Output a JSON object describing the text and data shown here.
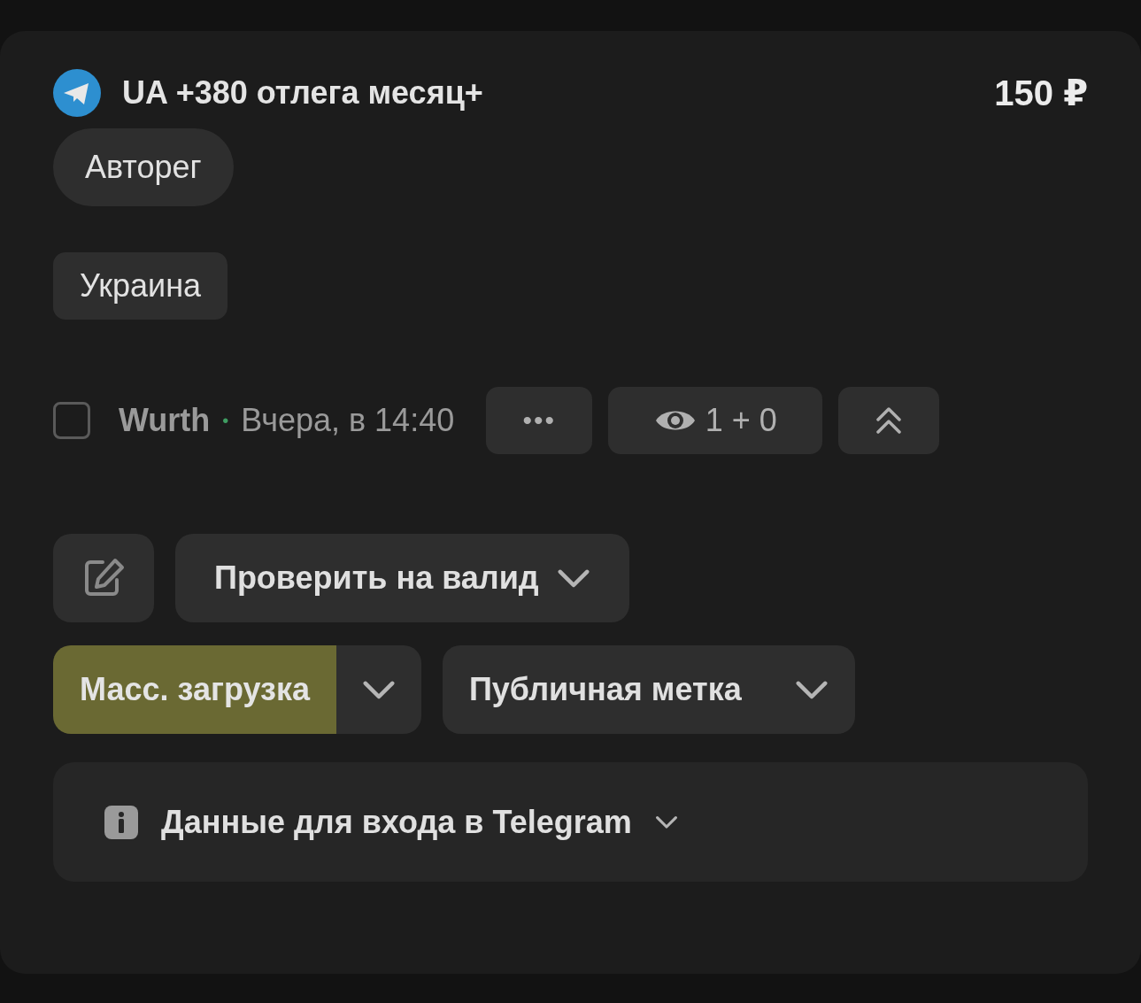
{
  "listing": {
    "title": "UA +380 отлега месяц+",
    "price": "150 ₽"
  },
  "tags": [
    {
      "label": "Авторег",
      "kind": "pill"
    },
    {
      "label": "Украина",
      "kind": "rect"
    }
  ],
  "meta": {
    "checked": false,
    "author": "Wurth",
    "separator": "•",
    "time": "Вчера, в 14:40",
    "more": "•••",
    "views": "1 + 0"
  },
  "actions": {
    "check_label": "Проверить на валид",
    "mass_upload": "Масс. загрузка",
    "public_tag": "Публичная метка"
  },
  "info": {
    "label": "Данные для входа в Telegram"
  }
}
